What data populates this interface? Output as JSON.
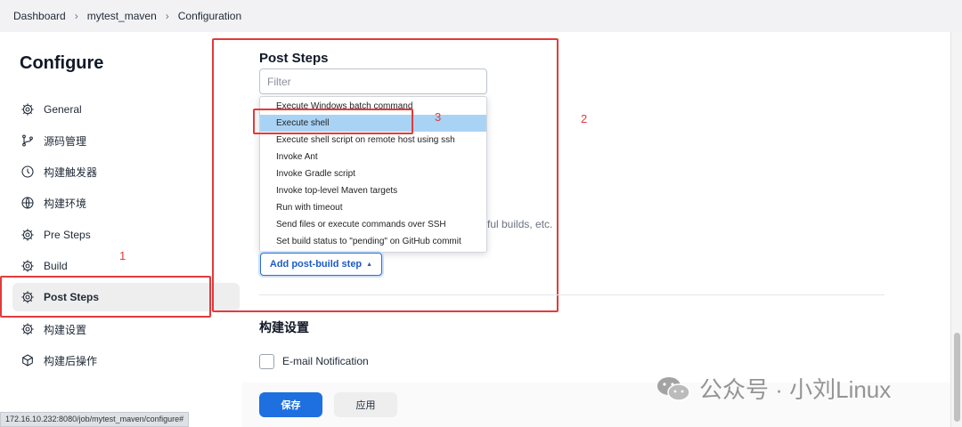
{
  "breadcrumb": {
    "items": [
      "Dashboard",
      "mytest_maven",
      "Configuration"
    ]
  },
  "page_title": "Configure",
  "sidebar": {
    "items": [
      {
        "label": "General",
        "icon": "gear-icon"
      },
      {
        "label": "源码管理",
        "icon": "branch-icon"
      },
      {
        "label": "构建触发器",
        "icon": "clock-icon"
      },
      {
        "label": "构建环境",
        "icon": "globe-icon"
      },
      {
        "label": "Pre Steps",
        "icon": "gear-icon"
      },
      {
        "label": "Build",
        "icon": "gear-icon"
      },
      {
        "label": "Post Steps",
        "icon": "gear-icon",
        "active": true
      },
      {
        "label": "构建设置",
        "icon": "gear-icon"
      },
      {
        "label": "构建后操作",
        "icon": "cube-icon"
      }
    ]
  },
  "annotations": {
    "n1": "1",
    "n2": "2",
    "n3": "3",
    "color": "#e23b3b"
  },
  "post_steps": {
    "title": "Post Steps",
    "filter_placeholder": "Filter",
    "dropdown_items": [
      "Execute Windows batch command",
      "Execute shell",
      "Execute shell script on remote host using ssh",
      "Invoke Ant",
      "Invoke Gradle script",
      "Invoke top-level Maven targets",
      "Run with timeout",
      "Send files or execute commands over SSH",
      "Set build status to \"pending\" on GitHub commit"
    ],
    "highlighted_item": "Execute shell",
    "partial_text": "ful builds, etc.",
    "add_button_label": "Add post-build step",
    "add_button_caret": "▲"
  },
  "build_settings": {
    "title": "构建设置",
    "email_label": "E-mail Notification"
  },
  "footer": {
    "save_label": "保存",
    "apply_label": "应用"
  },
  "status_url": "172.16.10.232:8080/job/mytest_maven/configure#",
  "watermark": "公众号 · 小刘Linux",
  "colors": {
    "primary": "#1e6fe0",
    "highlight": "#a9d3f5",
    "annotation": "#e23b3b"
  }
}
